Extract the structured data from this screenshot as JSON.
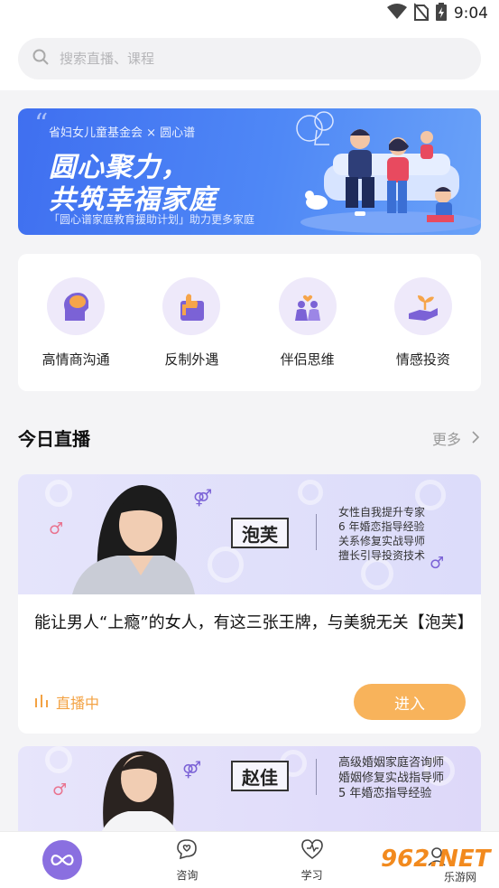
{
  "status_bar": {
    "time": "9:04"
  },
  "search": {
    "placeholder": "搜索直播、课程"
  },
  "banner": {
    "partner": "省妇女儿童基金会 × 圆心谱",
    "headline_1": "圆心聚力，",
    "headline_2": "共筑幸福家庭",
    "subtitle": "「圆心谱家庭教育援助计划」助力更多家庭"
  },
  "categories": [
    {
      "label": "高情商沟通",
      "icon": "head-brain-icon"
    },
    {
      "label": "反制外遇",
      "icon": "thumbs-up-icon"
    },
    {
      "label": "伴侣思维",
      "icon": "couple-heart-icon"
    },
    {
      "label": "情感投资",
      "icon": "hand-sprout-icon"
    }
  ],
  "live_section": {
    "title": "今日直播",
    "more": "更多"
  },
  "live_cards": [
    {
      "host": "泡芙",
      "desc": [
        "女性自我提升专家",
        "6 年婚恋指导经验",
        "关系修复实战导师",
        "擅长引导投资技术"
      ],
      "title": "能让男人“上瘾”的女人，有这三张王牌，与美貌无关【泡芙】",
      "status": "直播中",
      "button": "进入"
    },
    {
      "host": "赵佳",
      "desc": [
        "高级婚姻家庭咨询师",
        "婚姻修复实战指导师",
        "5 年婚恋指导经验"
      ]
    }
  ],
  "tabbar": [
    {
      "label": "",
      "icon": "infinity-home-icon"
    },
    {
      "label": "咨询",
      "icon": "chat-heart-icon"
    },
    {
      "label": "学习",
      "icon": "heart-pulse-icon"
    },
    {
      "label": "",
      "icon": "profile-icon"
    }
  ],
  "watermark": {
    "brand": "962.NET",
    "sub": "乐游网"
  },
  "colors": {
    "accent": "#f8b35b",
    "live": "#f3a243",
    "primary": "#8a6fe0",
    "banner": "#4f88f6"
  }
}
